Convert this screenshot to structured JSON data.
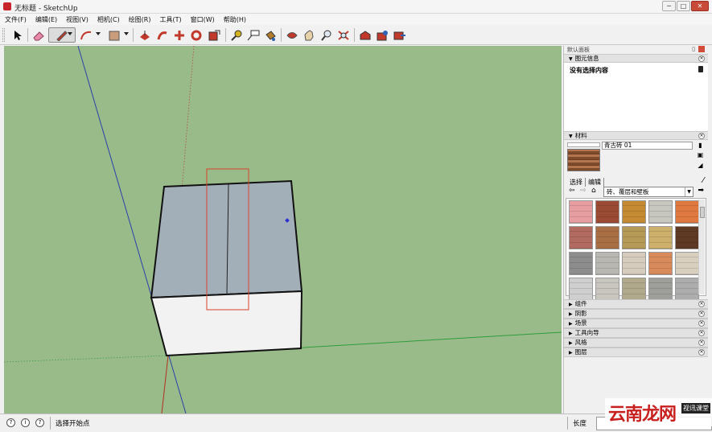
{
  "window": {
    "title": "无标题 - SketchUp",
    "buttons": [
      "─",
      "□",
      "✕"
    ]
  },
  "menu": [
    "文件(F)",
    "编辑(E)",
    "视图(V)",
    "相机(C)",
    "绘图(R)",
    "工具(T)",
    "窗口(W)",
    "帮助(H)"
  ],
  "tray": {
    "title": "默认面板",
    "entity_info": {
      "header": "图元信息",
      "text": "没有选择内容"
    },
    "materials": {
      "header": "材料",
      "current_name": "青古砖 01",
      "tab_select": "选择",
      "tab_edit": "编辑",
      "category": "砖、覆层和壁板",
      "swatch_colors": [
        "#e79ea0",
        "#9b4a33",
        "#c58b32",
        "#c7c7c0",
        "#e0793f",
        "#b26b60",
        "#a86f45",
        "#b59a57",
        "#ccb06b",
        "#5e3a24",
        "#8d8d8d",
        "#b9b7b2",
        "#d6ccbd",
        "#d98a5b",
        "#d8cfbe",
        "#cfcfcf",
        "#c8c6bf",
        "#b1a98c",
        "#9e9e9a",
        "#adadad"
      ]
    },
    "collapsed_panels": [
      "组件",
      "阴影",
      "场景",
      "工具向导",
      "风格",
      "图层"
    ]
  },
  "status": {
    "text": "选择开始点",
    "measure_label": "长度",
    "measure_value": ""
  },
  "watermark": {
    "logo": "云南龙网",
    "tag": "视讯课堂"
  },
  "colors": {
    "viewport": "#99bb8a",
    "box_top": "#a3afb8",
    "box_front": "#f2f2f2",
    "selection": "#d9432c"
  }
}
